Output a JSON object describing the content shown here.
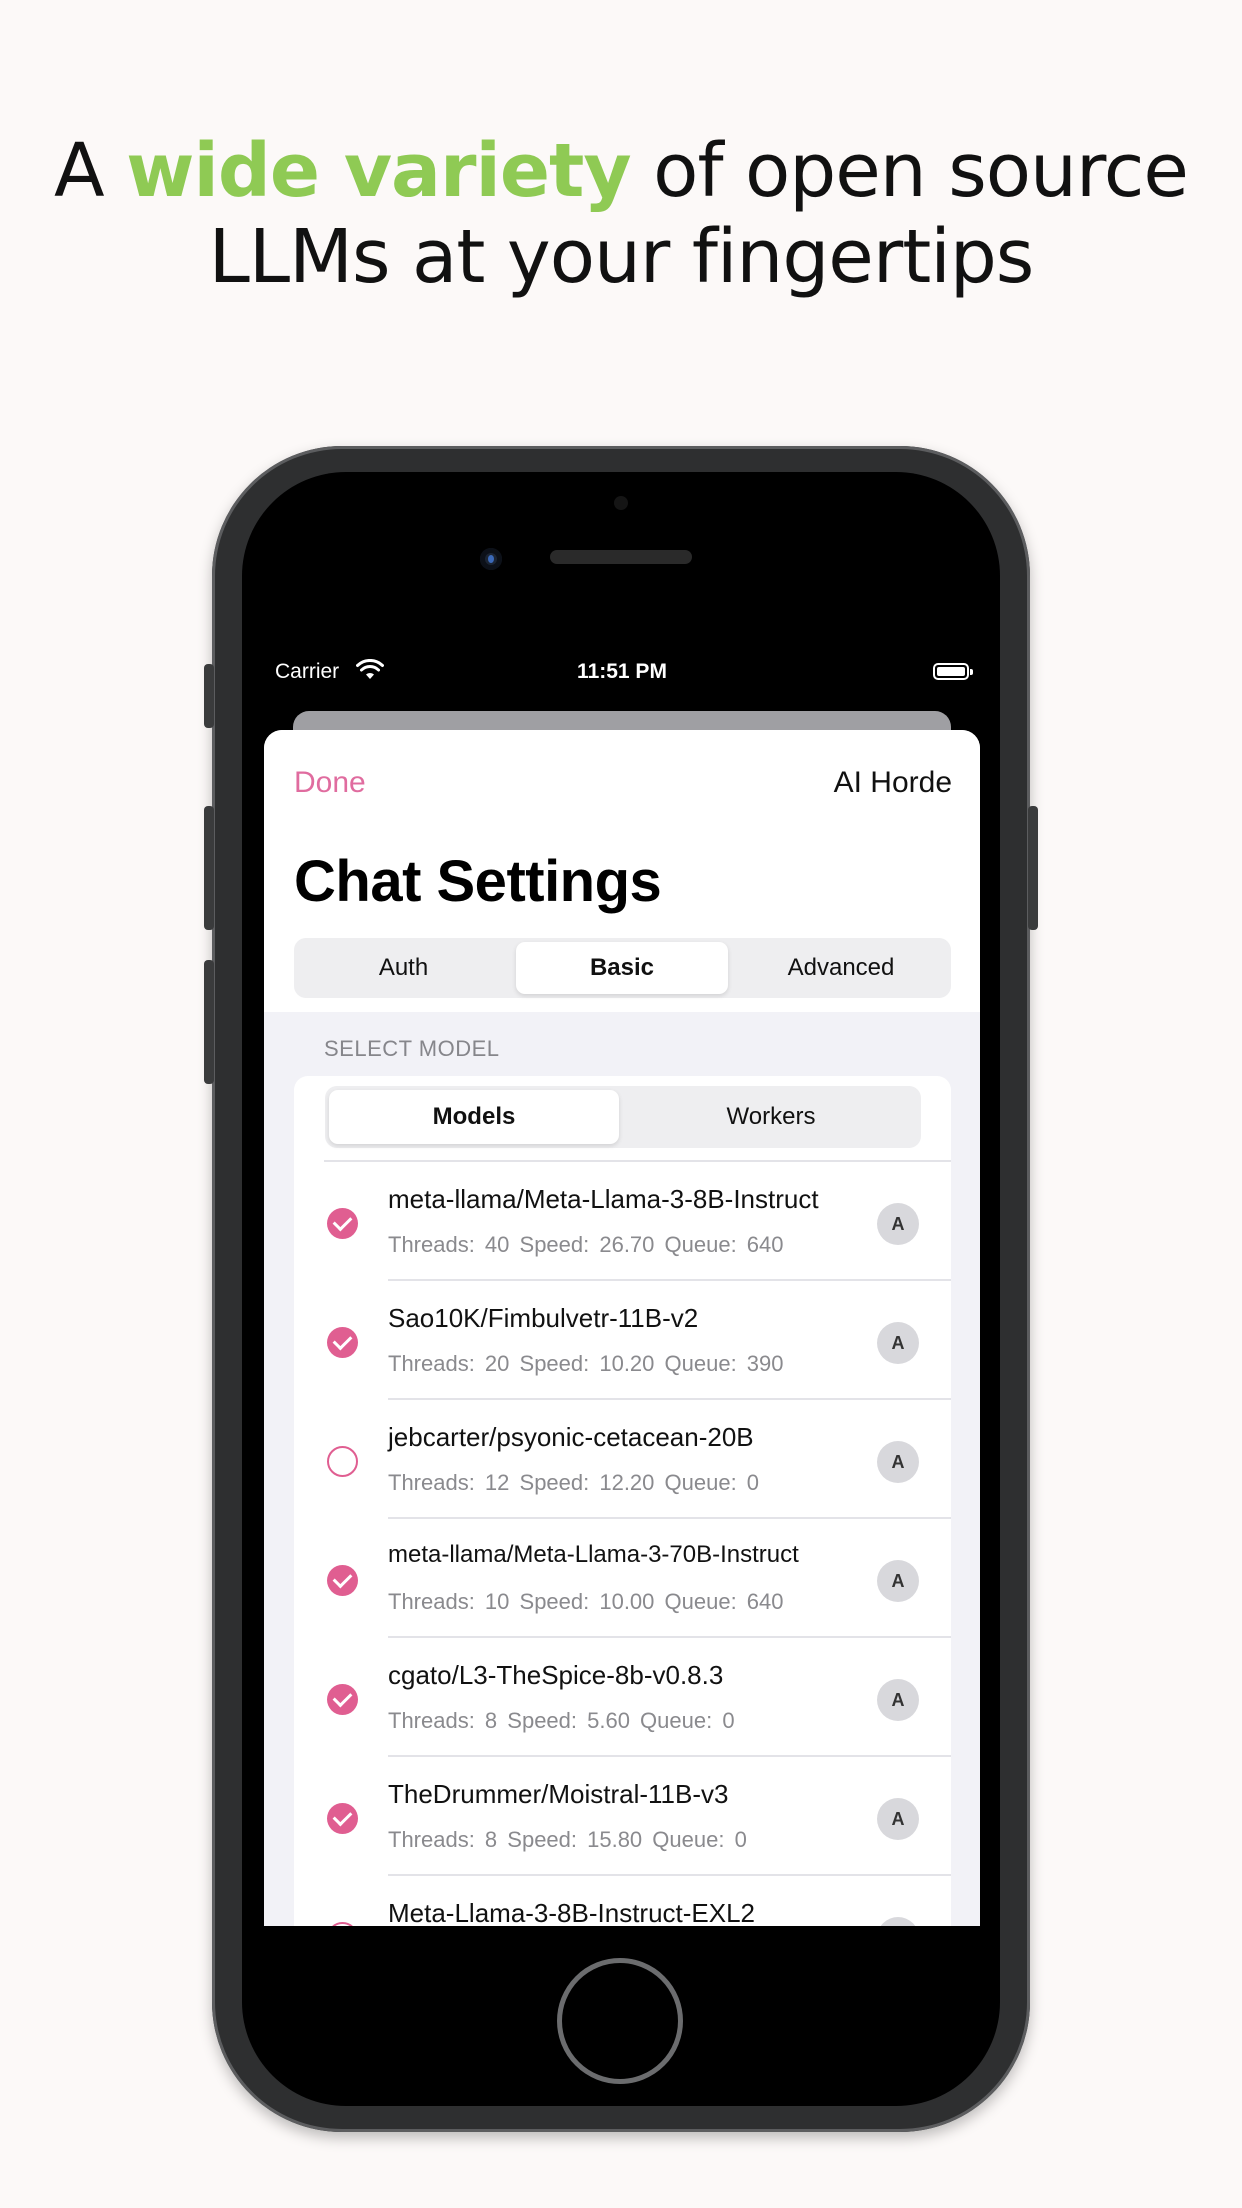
{
  "headline": {
    "prefix": "A ",
    "highlight": "wide variety",
    "suffix_line1": " of open source",
    "line2": "LLMs at your fingertips",
    "highlight_color": "#8fca54"
  },
  "status_bar": {
    "carrier": "Carrier",
    "time": "11:51 PM"
  },
  "nav": {
    "done_label": "Done",
    "right_label": "AI Horde",
    "accent_color": "#e06c9f"
  },
  "page_title": "Chat Settings",
  "tabs": [
    {
      "label": "Auth",
      "selected": false
    },
    {
      "label": "Basic",
      "selected": true
    },
    {
      "label": "Advanced",
      "selected": false
    }
  ],
  "section_header": "SELECT MODEL",
  "subtabs": [
    {
      "label": "Models",
      "selected": true
    },
    {
      "label": "Workers",
      "selected": false
    }
  ],
  "models": [
    {
      "name": "meta-llama/Meta-Llama-3-8B-Instruct",
      "stats": "Threads: 40  Speed: 26.70  Queue: 640",
      "checked": true,
      "badge": "A"
    },
    {
      "name": "Sao10K/Fimbulvetr-11B-v2",
      "stats": "Threads: 20  Speed: 10.20  Queue: 390",
      "checked": true,
      "badge": "A"
    },
    {
      "name": "jebcarter/psyonic-cetacean-20B",
      "stats": "Threads: 12  Speed: 12.20  Queue: 0",
      "checked": false,
      "badge": "A"
    },
    {
      "name": "meta-llama/Meta-Llama-3-70B-Instruct",
      "stats": "Threads: 10  Speed: 10.00  Queue: 640",
      "checked": true,
      "badge": "A"
    },
    {
      "name": "cgato/L3-TheSpice-8b-v0.8.3",
      "stats": "Threads: 8  Speed: 5.60  Queue: 0",
      "checked": true,
      "badge": "A"
    },
    {
      "name": "TheDrummer/Moistral-11B-v3",
      "stats": "Threads: 8  Speed: 15.80  Queue: 0",
      "checked": true,
      "badge": "A"
    },
    {
      "name": "Meta-Llama-3-8B-Instruct-EXL2",
      "stats": "",
      "checked": false,
      "badge": "A"
    }
  ]
}
